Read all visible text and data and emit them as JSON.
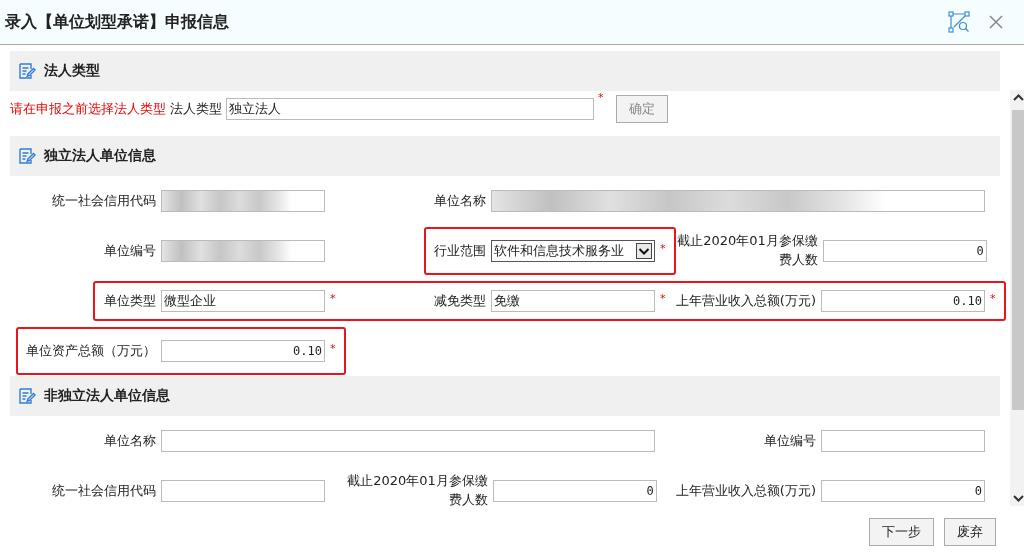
{
  "window": {
    "title": "录入【单位划型承诺】申报信息"
  },
  "sections": [
    {
      "title": "法人类型",
      "kind": "choose",
      "hint": "请在申报之前选择法人类型",
      "field": {
        "label": "法人类型",
        "value": "独立法人",
        "mark": "*"
      },
      "button": "确定"
    },
    {
      "title": "独立法人单位信息",
      "kind": "grid",
      "rows": [
        {
          "highlighted": false,
          "fields": [
            {
              "label": "统一社会信用代码",
              "kind": "text",
              "redacted": true
            },
            {
              "label": "单位名称",
              "kind": "text",
              "redacted": true,
              "wide": true
            }
          ]
        },
        {
          "highlighted": false,
          "fields": [
            {
              "label": "单位编号",
              "kind": "text",
              "redacted": true
            },
            {
              "label": "行业范围",
              "kind": "select",
              "value": "软件和信息技术服务业",
              "mark": "*",
              "highlighted": true
            },
            {
              "label": "截止2020年01月参保缴费人数",
              "kind": "number",
              "value": "0"
            }
          ]
        },
        {
          "highlighted": true,
          "fields": [
            {
              "label": "单位类型",
              "kind": "text",
              "value": "微型企业",
              "mark": "*"
            },
            {
              "label": "减免类型",
              "kind": "text",
              "value": "免缴",
              "mark": "*"
            },
            {
              "label": "上年营业收入总额(万元)",
              "kind": "number",
              "value": "0.10",
              "mark": "*"
            }
          ]
        },
        {
          "highlighted": false,
          "fields": [
            {
              "label": "单位资产总额（万元）",
              "kind": "number",
              "value": "0.10",
              "mark": "*",
              "highlighted": true
            }
          ]
        }
      ]
    },
    {
      "title": "非独立法人单位信息",
      "kind": "grid",
      "rows": [
        {
          "highlighted": false,
          "fields": [
            {
              "label": "单位名称",
              "kind": "text",
              "wide": true
            },
            {
              "label": "单位编号",
              "kind": "text"
            }
          ]
        },
        {
          "highlighted": false,
          "fields": [
            {
              "label": "统一社会信用代码",
              "kind": "text"
            },
            {
              "label": "截止2020年01月参保缴费人数",
              "kind": "number",
              "value": "0"
            },
            {
              "label": "上年营业收入总额(万元)",
              "kind": "number",
              "value": "0"
            }
          ]
        }
      ]
    }
  ],
  "buttons": [
    "下一步",
    "废弃"
  ]
}
